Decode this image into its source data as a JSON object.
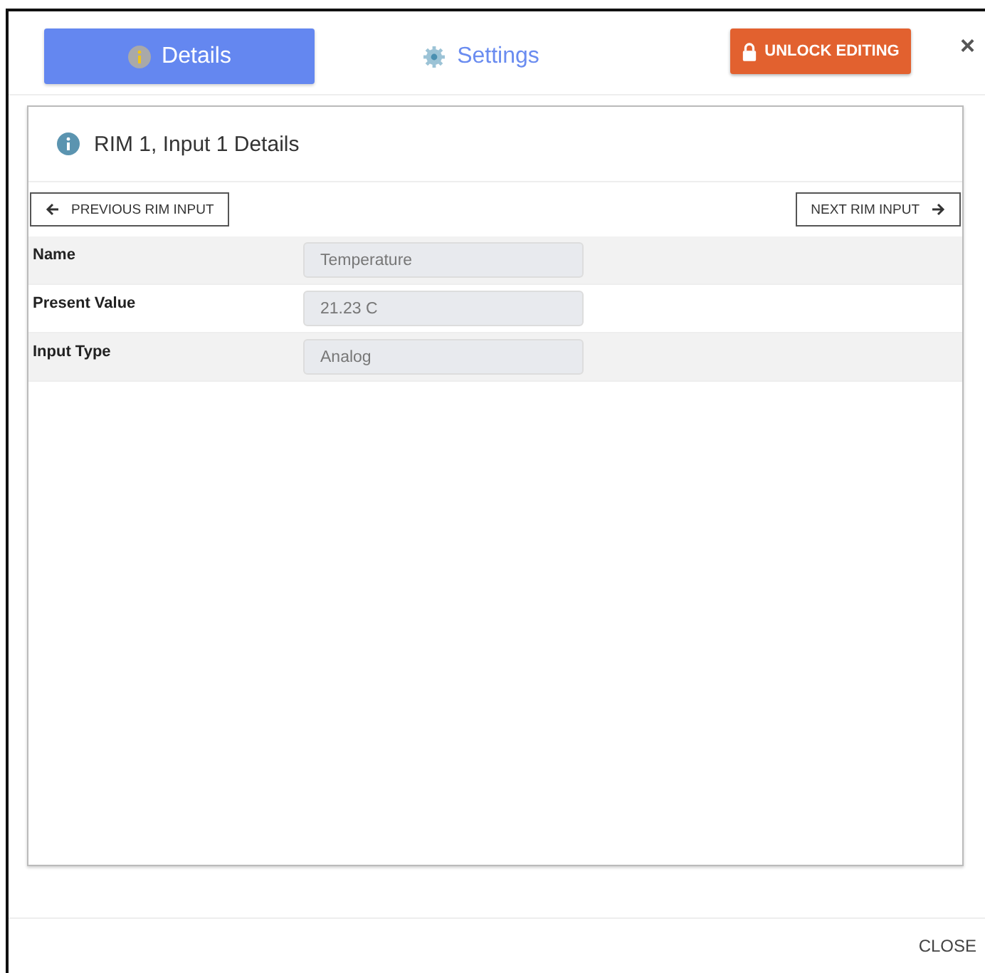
{
  "tabs": [
    {
      "label": "Details",
      "kind": "info",
      "selected": true
    },
    {
      "label": "Settings",
      "kind": "gear",
      "selected": false
    }
  ],
  "unlock_button": "UNLOCK EDITING",
  "close_icon": "×",
  "panel": {
    "title": "RIM 1, Input 1 Details",
    "previous_button": "PREVIOUS RIM INPUT",
    "next_button": "NEXT RIM INPUT",
    "fields": [
      {
        "label": "Name",
        "value": "Temperature"
      },
      {
        "label": "Present Value",
        "value": "21.23 C"
      },
      {
        "label": "Input Type",
        "value": "Analog"
      }
    ]
  },
  "footer": {
    "close_button": "CLOSE"
  }
}
